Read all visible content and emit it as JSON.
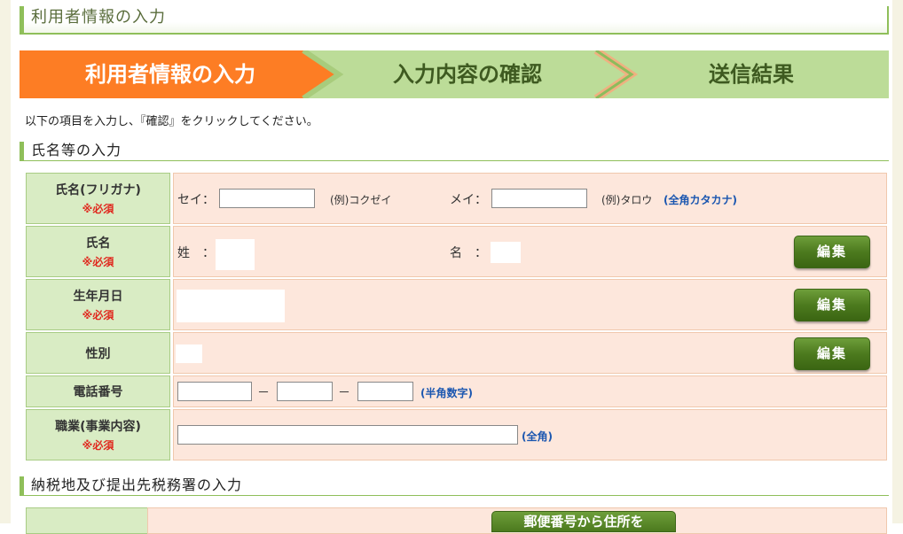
{
  "page_title": "利用者情報の入力",
  "steps": [
    "利用者情報の入力",
    "入力内容の確認",
    "送信結果"
  ],
  "instruction": "以下の項目を入力し、『確認』をクリックしてください。",
  "section1_title": "氏名等の入力",
  "section2_title": "納税地及び提出先税務署の入力",
  "required_mark": "※必須",
  "rows": {
    "furigana": {
      "label": "氏名(フリガナ)",
      "sei_label": "セイ：",
      "sei_value": "",
      "sei_example": "(例)コクゼイ",
      "mei_label": "メイ：",
      "mei_value": "",
      "mei_example": "(例)タロウ",
      "note": "(全角カタカナ)"
    },
    "name": {
      "label": "氏名",
      "sei_label": "姓　：",
      "mei_label": "名　："
    },
    "birthdate": {
      "label": "生年月日"
    },
    "gender": {
      "label": "性別"
    },
    "phone": {
      "label": "電話番号",
      "sep": "－",
      "note": "(半角数字)"
    },
    "occupation": {
      "label": "職業(事業内容)",
      "note": "(全角)"
    }
  },
  "edit_button": "編集",
  "zip_button": "郵便番号から住所を",
  "colors": {
    "step_active": "#fd7d24",
    "step_inactive": "#bcdc98",
    "label_bg": "#d9ecc4",
    "value_bg": "#fde7dc",
    "required": "#e0281e",
    "note": "#1a56b0"
  }
}
